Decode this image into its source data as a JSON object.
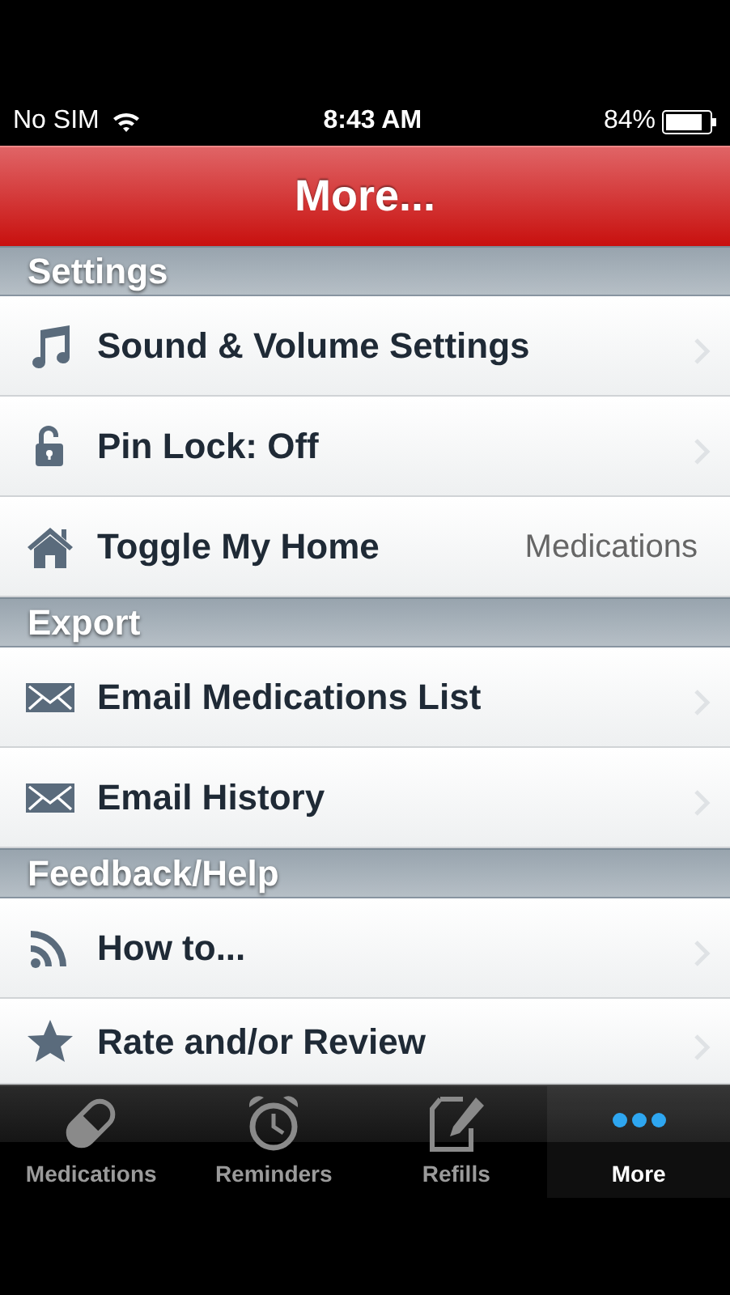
{
  "status_bar": {
    "carrier": "No SIM",
    "time": "8:43 AM",
    "battery": "84%"
  },
  "nav_bar": {
    "title": "More..."
  },
  "sections": [
    {
      "title": "Settings",
      "rows": [
        {
          "kind": "music",
          "label": "Sound & Volume Settings"
        },
        {
          "kind": "lock",
          "label": "Pin Lock: Off"
        },
        {
          "kind": "home",
          "label": "Toggle My Home",
          "detail": "Medications"
        }
      ]
    },
    {
      "title": "Export",
      "rows": [
        {
          "kind": "mail",
          "label": "Email Medications List"
        },
        {
          "kind": "mail",
          "label": "Email History"
        }
      ]
    },
    {
      "title": "Feedback/Help",
      "rows": [
        {
          "kind": "rss",
          "label": "How to..."
        },
        {
          "kind": "star",
          "label": "Rate and/or Review"
        }
      ]
    }
  ],
  "tab_bar": [
    {
      "kind": "pill",
      "label": "Medications",
      "selected": false
    },
    {
      "kind": "clock",
      "label": "Reminders",
      "selected": false
    },
    {
      "kind": "edit",
      "label": "Refills",
      "selected": false
    },
    {
      "kind": "dots",
      "label": "More",
      "selected": true
    }
  ]
}
